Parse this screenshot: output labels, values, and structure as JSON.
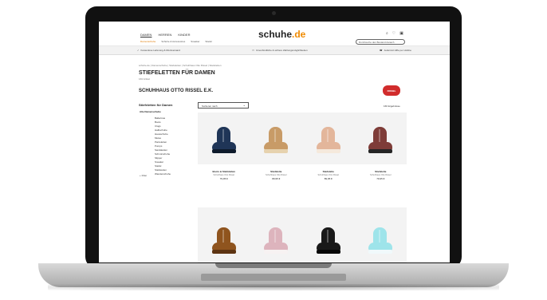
{
  "site": {
    "logo_text": "schuhe",
    "logo_accent": ".de",
    "brand_color": "#f08a00"
  },
  "header": {
    "gender_tabs": [
      "DAMEN",
      "HERREN",
      "KINDER"
    ],
    "active_gender": "DAMEN",
    "category_tabs": [
      "Damenschuhe",
      "Schuhe & Accessoires",
      "Sneaker",
      "Stiefel"
    ],
    "icons": [
      "search-icon",
      "wishlist-icon",
      "cart-icon"
    ],
    "search_placeholder": "Durchsuche den Bestand danach"
  },
  "infobar": {
    "items": [
      {
        "icon": "check-icon",
        "text": "Kostenlose Lieferung & Rückversand"
      },
      {
        "icon": "truck-icon",
        "text": "Unverbindliche & sichere Zahlungsmöglichkeiten"
      },
      {
        "icon": "phone-icon",
        "text": "Jederzeit Hilfe per Hotline"
      }
    ]
  },
  "page": {
    "breadcrumb": "schuhe.de  |  Damenschuhe  |  Stiefeletten  |  Schuhhaus Otto Rissel  |  Stiefeletten",
    "title": "STIEFELETTEN FÜR DAMEN",
    "article_count": "166 Artikel",
    "shop_title": "SCHUHHAUS OTTO RISSEL E.K.",
    "brand_logo": "RISSEL"
  },
  "sidebar": {
    "title": "Stiefeletten für Damen",
    "group": "Alle Damenschuhe",
    "items": [
      "Ballerinas",
      "Boots",
      "Clogs",
      "Halbschuhe",
      "Hausschuhe",
      "Mules",
      "Pantoletten",
      "Pumps",
      "Sandaletten",
      "Schnürschuhe",
      "Slipper",
      "Sneaker",
      "Stiefel",
      "Stiefeletten",
      "Wanderschuhe"
    ],
    "extra": "+ Filter"
  },
  "toolbar": {
    "sort_label": "Sortieren nach",
    "result_label": "166 Ergebnisse"
  },
  "products": [
    {
      "name": "Boots & Stiefeletten",
      "meta": "Schuhhaus Otto Rissel",
      "price": "79,95 €",
      "color": "#1f3557",
      "sole": "#0e1b2c"
    },
    {
      "name": "Stiefelette",
      "meta": "Schuhhaus Otto Rissel",
      "price": "89,95 €",
      "color": "#c89b67",
      "sole": "#e6d2ae"
    },
    {
      "name": "Stiefelette",
      "meta": "Schuhhaus Otto Rissel",
      "price": "89,95 €",
      "color": "#e3b69b",
      "sole": "#f5e9dc"
    },
    {
      "name": "Stiefelette",
      "meta": "Schuhhaus Otto Rissel",
      "price": "79,95 €",
      "color": "#7e3c38",
      "sole": "#252525"
    },
    {
      "name": "",
      "meta": "",
      "price": "",
      "color": "#8f541e",
      "sole": "#5d3412"
    },
    {
      "name": "",
      "meta": "",
      "price": "",
      "color": "#ddb4bd",
      "sole": "#f7f2f2"
    },
    {
      "name": "",
      "meta": "",
      "price": "",
      "color": "#191919",
      "sole": "#070707"
    },
    {
      "name": "",
      "meta": "",
      "price": "",
      "color": "#9ee4ea",
      "sole": "#f0f9fb"
    }
  ]
}
